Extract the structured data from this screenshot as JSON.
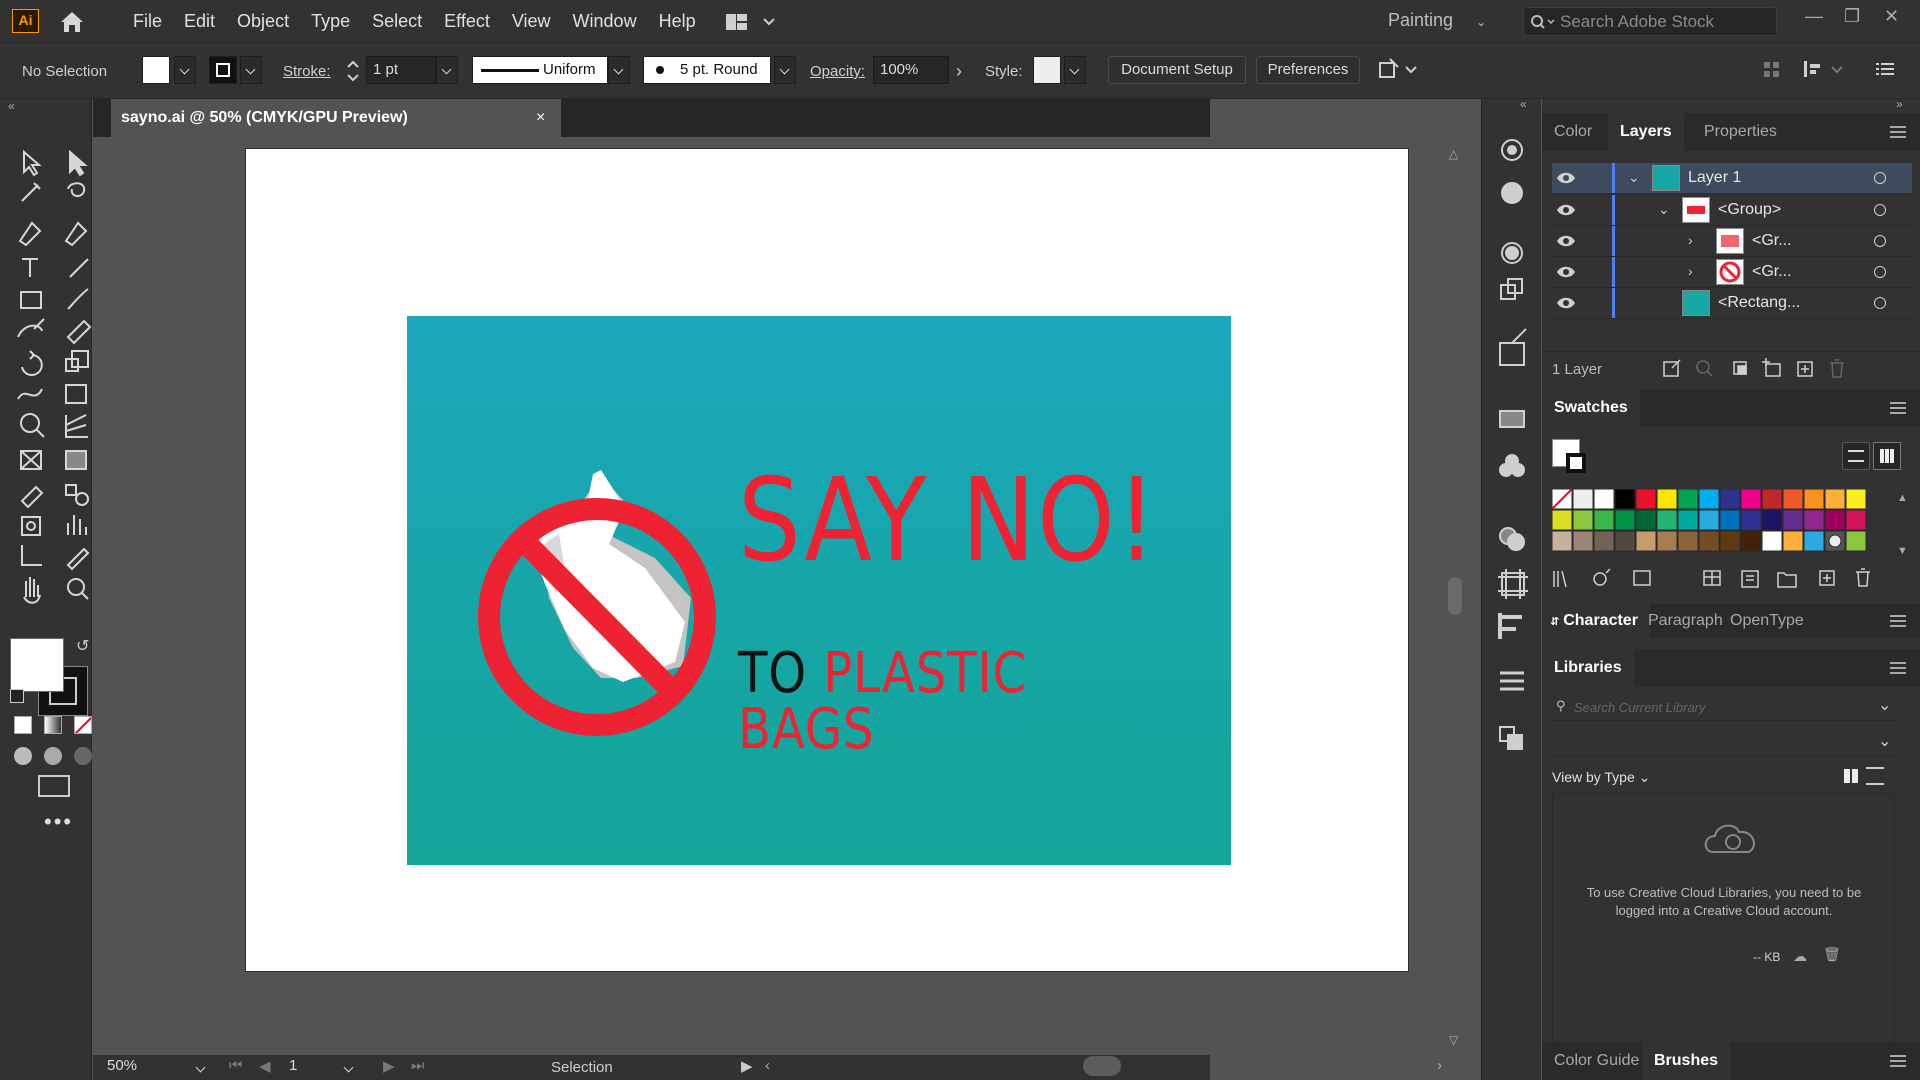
{
  "menu": {
    "app_icon": "Ai",
    "items": [
      "File",
      "Edit",
      "Object",
      "Type",
      "Select",
      "Effect",
      "View",
      "Window",
      "Help"
    ],
    "workspace": "Painting",
    "search_placeholder": "Search Adobe Stock"
  },
  "control": {
    "selection_label": "No Selection",
    "stroke_label": "Stroke:",
    "stroke_value": "1 pt",
    "profile": "Uniform",
    "brush": "5 pt. Round",
    "opacity_label": "Opacity:",
    "opacity_value": "100%",
    "style_label": "Style:",
    "doc_setup": "Document Setup",
    "preferences": "Preferences"
  },
  "document": {
    "tab_title": "sayno.ai @ 50% (CMYK/GPU Preview)",
    "close": "×",
    "headline": "SAY NO!",
    "sub_to": "TO",
    "sub_rest": "PLASTIC BAGS"
  },
  "status": {
    "zoom": "50%",
    "artboard": "1",
    "tool": "Selection"
  },
  "layers_panel": {
    "tabs": [
      "Color",
      "Layers",
      "Properties"
    ],
    "active_tab": "Layers",
    "rows": [
      {
        "name": "Layer 1",
        "level": 0,
        "expanded": true
      },
      {
        "name": "<Group>",
        "level": 1,
        "expanded": true
      },
      {
        "name": "<Gr...",
        "level": 2,
        "expanded": false
      },
      {
        "name": "<Gr...",
        "level": 2,
        "expanded": false
      },
      {
        "name": "<Rectang...",
        "level": 2,
        "expanded": null
      }
    ],
    "count": "1 Layer"
  },
  "swatches_panel": {
    "title": "Swatches"
  },
  "char_panel": {
    "tabs": [
      "Character",
      "Paragraph",
      "OpenType"
    ]
  },
  "libraries_panel": {
    "title": "Libraries",
    "search_placeholder": "Search Current Library",
    "view_by": "View by Type",
    "message": "To use Creative Cloud Libraries, you need to be logged into a Creative Cloud account.",
    "size": "-- KB"
  },
  "bottom_panel": {
    "tabs": [
      "Color Guide",
      "Brushes"
    ]
  },
  "colors": {
    "accent_red": "#ee2232",
    "teal_top": "#1ba8bd",
    "teal_bottom": "#13a598",
    "layer_blue": "#4e7ff2"
  }
}
